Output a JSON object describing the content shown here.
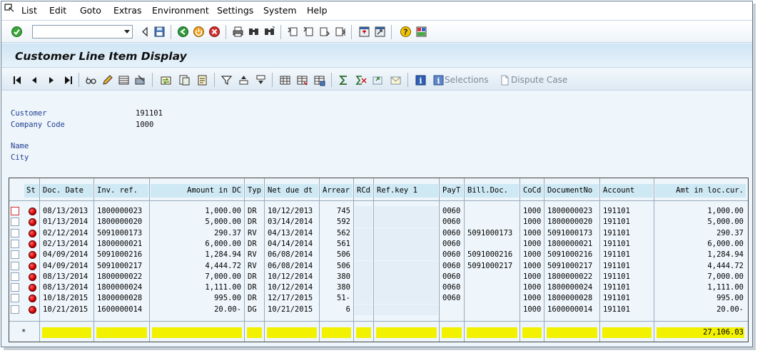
{
  "menu": {
    "items": [
      {
        "label": "List",
        "hotkey": "L"
      },
      {
        "label": "Edit",
        "hotkey": "E"
      },
      {
        "label": "Goto",
        "hotkey": "G"
      },
      {
        "label": "Extras",
        "hotkey": "r"
      },
      {
        "label": "Environment",
        "hotkey": "v"
      },
      {
        "label": "Settings",
        "hotkey": "S"
      },
      {
        "label": "System",
        "hotkey": "y"
      },
      {
        "label": "Help",
        "hotkey": "H"
      }
    ]
  },
  "command_field": {
    "value": "",
    "placeholder": ""
  },
  "title": "Customer Line Item Display",
  "app_toolbar": {
    "selections_label": "Selections",
    "dispute_label": "Dispute Case"
  },
  "header": {
    "customer_label": "Customer",
    "customer_value": "191101",
    "company_code_label": "Company Code",
    "company_code_value": "1000",
    "name_label": "Name",
    "city_label": "City"
  },
  "table": {
    "columns": [
      "St",
      "Doc. Date",
      "Inv. ref.",
      "Amount in DC",
      "Typ",
      "Net due dt",
      "Arrear",
      "RCd",
      "Ref.key 1",
      "PayT",
      "Bill.Doc.",
      "CoCd",
      "DocumentNo",
      "Account",
      "Amt in loc.cur."
    ],
    "rows": [
      {
        "doc_date": "08/13/2013",
        "inv_ref": "1800000023",
        "amount_dc": "1,000.00",
        "typ": "DR",
        "net_due": "10/12/2013",
        "arrear": "745",
        "rcd": "",
        "refkey": "",
        "payt": "0060",
        "billdoc": "",
        "cocd": "1000",
        "docno": "1800000023",
        "account": "191101",
        "amt_loc": "1,000.00"
      },
      {
        "doc_date": "01/13/2014",
        "inv_ref": "1800000020",
        "amount_dc": "5,000.00",
        "typ": "DR",
        "net_due": "03/14/2014",
        "arrear": "592",
        "rcd": "",
        "refkey": "",
        "payt": "0060",
        "billdoc": "",
        "cocd": "1000",
        "docno": "1800000020",
        "account": "191101",
        "amt_loc": "5,000.00"
      },
      {
        "doc_date": "02/12/2014",
        "inv_ref": "5091000173",
        "amount_dc": "290.37",
        "typ": "RV",
        "net_due": "04/13/2014",
        "arrear": "562",
        "rcd": "",
        "refkey": "",
        "payt": "0060",
        "billdoc": "5091000173",
        "cocd": "1000",
        "docno": "5091000173",
        "account": "191101",
        "amt_loc": "290.37"
      },
      {
        "doc_date": "02/13/2014",
        "inv_ref": "1800000021",
        "amount_dc": "6,000.00",
        "typ": "DR",
        "net_due": "04/14/2014",
        "arrear": "561",
        "rcd": "",
        "refkey": "",
        "payt": "0060",
        "billdoc": "",
        "cocd": "1000",
        "docno": "1800000021",
        "account": "191101",
        "amt_loc": "6,000.00"
      },
      {
        "doc_date": "04/09/2014",
        "inv_ref": "5091000216",
        "amount_dc": "1,284.94",
        "typ": "RV",
        "net_due": "06/08/2014",
        "arrear": "506",
        "rcd": "",
        "refkey": "",
        "payt": "0060",
        "billdoc": "5091000216",
        "cocd": "1000",
        "docno": "5091000216",
        "account": "191101",
        "amt_loc": "1,284.94"
      },
      {
        "doc_date": "04/09/2014",
        "inv_ref": "5091000217",
        "amount_dc": "4,444.72",
        "typ": "RV",
        "net_due": "06/08/2014",
        "arrear": "506",
        "rcd": "",
        "refkey": "",
        "payt": "0060",
        "billdoc": "5091000217",
        "cocd": "1000",
        "docno": "5091000217",
        "account": "191101",
        "amt_loc": "4,444.72"
      },
      {
        "doc_date": "08/13/2014",
        "inv_ref": "1800000022",
        "amount_dc": "7,000.00",
        "typ": "DR",
        "net_due": "10/12/2014",
        "arrear": "380",
        "rcd": "",
        "refkey": "",
        "payt": "0060",
        "billdoc": "",
        "cocd": "1000",
        "docno": "1800000022",
        "account": "191101",
        "amt_loc": "7,000.00"
      },
      {
        "doc_date": "08/13/2014",
        "inv_ref": "1800000024",
        "amount_dc": "1,111.00",
        "typ": "DR",
        "net_due": "10/12/2014",
        "arrear": "380",
        "rcd": "",
        "refkey": "",
        "payt": "0060",
        "billdoc": "",
        "cocd": "1000",
        "docno": "1800000024",
        "account": "191101",
        "amt_loc": "1,111.00"
      },
      {
        "doc_date": "10/18/2015",
        "inv_ref": "1800000028",
        "amount_dc": "995.00",
        "typ": "DR",
        "net_due": "12/17/2015",
        "arrear": "51-",
        "rcd": "",
        "refkey": "",
        "payt": "0060",
        "billdoc": "",
        "cocd": "1000",
        "docno": "1800000028",
        "account": "191101",
        "amt_loc": "995.00"
      },
      {
        "doc_date": "10/21/2015",
        "inv_ref": "1600000014",
        "amount_dc": "20.00-",
        "typ": "DG",
        "net_due": "10/21/2015",
        "arrear": "6",
        "rcd": "",
        "refkey": "",
        "payt": "",
        "billdoc": "",
        "cocd": "1000",
        "docno": "1600000014",
        "account": "191101",
        "amt_loc": "20.00-"
      }
    ],
    "total_marker": "*",
    "total_amt_loc": "27,106.03"
  },
  "colors": {
    "title_bg": "#cfe5f4",
    "header_cell_bg": "#cfe9f4",
    "total_row_bg": "#f2f200",
    "status_red": "#d60000",
    "label_blue": "#1f3f8f"
  }
}
